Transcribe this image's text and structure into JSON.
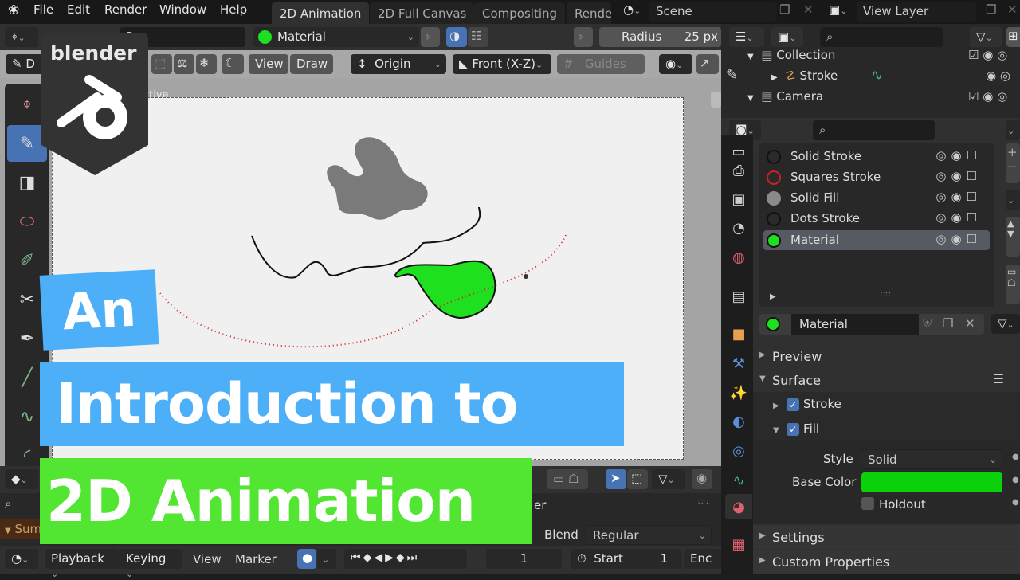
{
  "topbar": {
    "menu": [
      "File",
      "Edit",
      "Render",
      "Window",
      "Help"
    ],
    "workspace_tabs": [
      "2D Animation",
      "2D Full Canvas",
      "Compositing",
      "Rende"
    ],
    "scene_label": "Scene",
    "view_layer_label": "View Layer"
  },
  "tool_header": {
    "brush_name": "Pen",
    "material_name": "Material",
    "radius_label": "Radius",
    "radius_value": "25 px",
    "color_swatch": "#4caf50"
  },
  "viewport_header": {
    "mode_label": "D",
    "view_label": "View",
    "draw_label": "Draw",
    "origin_label": "Origin",
    "projection_label": "Front (X-Z)",
    "guides_label": "Guides",
    "perspective_text": "ective"
  },
  "logo": {
    "text": "blender"
  },
  "overlay_title": {
    "line1": "An",
    "line2": "Introduction to",
    "line3": "2D Animation"
  },
  "outliner": {
    "items": [
      {
        "label": "Collection",
        "kind": "collection"
      },
      {
        "label": "Stroke",
        "kind": "gpencil"
      },
      {
        "label": "Camera",
        "kind": "collection"
      }
    ]
  },
  "material_slots": [
    {
      "label": "Solid Stroke",
      "color": "#2a2a2a",
      "border": "#111"
    },
    {
      "label": "Squares Stroke",
      "color": "#2a2a2a",
      "border": "#d02020"
    },
    {
      "label": "Solid Fill",
      "color": "#8a8a8a",
      "border": "#8a8a8a"
    },
    {
      "label": "Dots Stroke",
      "color": "#2a2a2a",
      "border": "#111"
    },
    {
      "label": "Material",
      "color": "#1ee01e",
      "border": "#111",
      "selected": true
    }
  ],
  "material_panel": {
    "material_name": "Material",
    "sections": {
      "preview": "Preview",
      "surface": "Surface",
      "stroke": "Stroke",
      "fill": "Fill",
      "settings": "Settings",
      "custom_properties": "Custom Properties"
    },
    "stroke_checked": true,
    "fill_checked": true,
    "style_label": "Style",
    "style_value": "Solid",
    "base_color_label": "Base Color",
    "base_color": "#0ad10a",
    "holdout_label": "Holdout",
    "holdout_checked": false
  },
  "dopesheet": {
    "summary_label": "Sum",
    "layer_text": "er",
    "blend_label": "Blend",
    "blend_value": "Regular"
  },
  "timeline": {
    "playback_label": "Playback",
    "keying_label": "Keying",
    "view_label": "View",
    "marker_label": "Marker",
    "current_frame": "1",
    "start_label": "Start",
    "start_value": "1",
    "end_label": "Enc"
  }
}
